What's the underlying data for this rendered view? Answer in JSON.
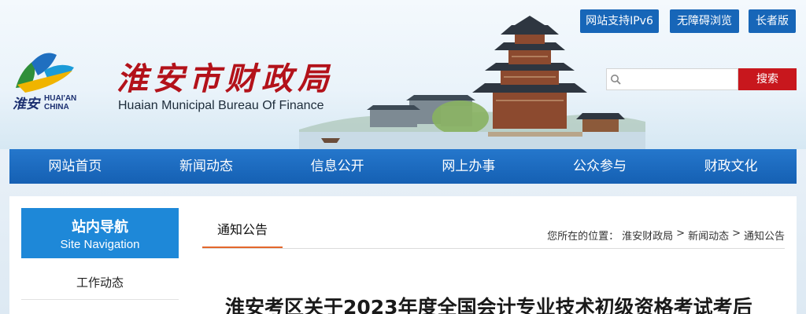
{
  "header": {
    "logo_text_cn": "淮安市财政局",
    "logo_text_en": "Huaian Municipal Bureau Of Finance",
    "emblem_text_cn": "淮安",
    "emblem_text_en_1": "HUAI'AN",
    "emblem_text_en_2": "CHINA",
    "top_buttons": [
      "网站支持IPv6",
      "无障碍浏览",
      "长者版"
    ],
    "search_placeholder": "",
    "search_button": "搜索"
  },
  "nav": {
    "items": [
      "网站首页",
      "新闻动态",
      "信息公开",
      "网上办事",
      "公众参与",
      "财政文化"
    ]
  },
  "sidebar": {
    "title_cn": "站内导航",
    "title_en": "Site Navigation",
    "items": [
      "工作动态"
    ]
  },
  "main": {
    "tab": "通知公告",
    "breadcrumb": {
      "prefix": "您所在的位置：",
      "items": [
        "淮安财政局",
        "新闻动态",
        "通知公告"
      ],
      "separator": ">"
    },
    "article_title": "淮安考区关于2023年度全国会计专业技术初级资格考试考后"
  },
  "colors": {
    "nav_blue": "#1766b8",
    "search_red": "#c8171d",
    "title_red": "#b3121a",
    "sidebar_blue": "#1e88d8",
    "tab_underline": "#e3672b"
  },
  "icons": {
    "search": "search-icon",
    "emblem": "city-emblem-icon",
    "pagoda": "pagoda-scene-illustration"
  }
}
